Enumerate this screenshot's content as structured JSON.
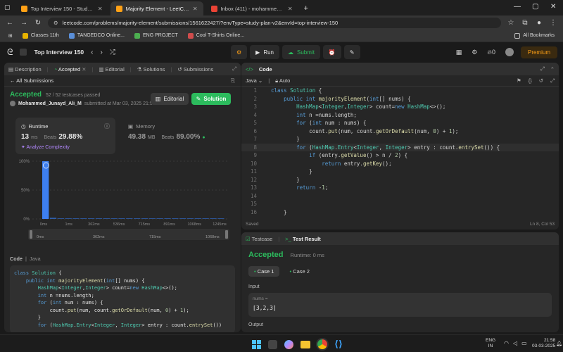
{
  "browser": {
    "tabs": [
      {
        "title": "Top Interview 150 - Study Plan",
        "color": "#ffa116"
      },
      {
        "title": "Majority Element - LeetCode",
        "color": "#ffa116"
      },
      {
        "title": "Inbox (411) - mohammedjunay",
        "color": "#ea4335"
      }
    ],
    "new_tab": "+",
    "url": "leetcode.com/problems/majority-element/submissions/1561622427/?envType=study-plan-v2&envId=top-interview-150",
    "bookmarks": [
      "Classes 11th",
      "TANGEDCO Online...",
      "ENG PROJECT",
      "Cool T-Shirts Online..."
    ],
    "all_bookmarks": "All Bookmarks"
  },
  "header": {
    "study_plan": "Top Interview 150",
    "run": "Run",
    "submit": "Submit",
    "streak": "0",
    "premium": "Premium"
  },
  "left": {
    "tabs": [
      "Description",
      "Accepted",
      "Editorial",
      "Solutions",
      "Submissions"
    ],
    "back": "All Submissions",
    "status": "Accepted",
    "testcases": "52 / 52 testcases passed",
    "user": "Mohammed_Junayd_Ali_M",
    "submitted": "submitted at Mar 03, 2025 21:57",
    "editorial_btn": "Editorial",
    "solution_btn": "Solution",
    "runtime_label": "Runtime",
    "runtime_value": "13",
    "runtime_unit": "ms",
    "runtime_beats_label": "Beats",
    "runtime_beats": "29.88%",
    "analyze": "Analyze Complexity",
    "memory_label": "Memory",
    "memory_value": "49.38",
    "memory_unit": "MB",
    "memory_beats_label": "Beats",
    "memory_beats": "89.00%",
    "code_label": "Code",
    "code_lang": "Java",
    "code": [
      "class Solution {",
      "    public int majorityElement(int[] nums) {",
      "        HashMap<Integer,Integer> count=new HashMap<>();",
      "        int n =nums.length;",
      "        for (int num : nums) {",
      "            count.put(num, count.getOrDefault(num, 0) + 1);",
      "        }",
      "        for (HashMap.Entry<Integer, Integer> entry : count.entrySet())"
    ]
  },
  "chart_data": {
    "type": "bar",
    "y_ticks": [
      "100%",
      "50%",
      "0%"
    ],
    "x_ticks": [
      "0ms",
      "1ms",
      "362ms",
      "536ms",
      "715ms",
      "891ms",
      "1068ms",
      "1245ms"
    ],
    "mini_ticks": [
      "0ms",
      "362ms",
      "715ms",
      "1068ms"
    ],
    "highlight_value": 13,
    "highlight_unit": "ms",
    "bars_percent": [
      100,
      2,
      1,
      1,
      1,
      1,
      1,
      1,
      1,
      1,
      1,
      1,
      1,
      1,
      1,
      1,
      1,
      1,
      1,
      1,
      1,
      1,
      1,
      1
    ]
  },
  "editor": {
    "title": "Code",
    "lang": "Java",
    "mode": "Auto",
    "saved": "Saved",
    "cursor": "Ln 8, Col 53",
    "lines": [
      "class Solution {",
      "    public int majorityElement(int[] nums) {",
      "        HashMap<Integer,Integer> count=new HashMap<>();",
      "        int n =nums.length;",
      "        for (int num : nums) {",
      "            count.put(num, count.getOrDefault(num, 0) + 1);",
      "        }",
      "        for (HashMap.Entry<Integer, Integer> entry : count.entrySet()) {",
      "            if (entry.getValue() > n / 2) {",
      "                return entry.getKey();",
      "            }",
      "        }",
      "        return -1;",
      "",
      "",
      "    }"
    ],
    "line_numbers": [
      "1",
      "2",
      "3",
      "4",
      "5",
      "6",
      "7",
      "8",
      "9",
      "10",
      "11",
      "12",
      "13",
      "14",
      "15",
      "16"
    ]
  },
  "testpanel": {
    "tab_testcase": "Testcase",
    "tab_result": "Test Result",
    "status": "Accepted",
    "runtime": "Runtime: 0 ms",
    "case1": "Case 1",
    "case2": "Case 2",
    "input_label": "Input",
    "var_label": "nums =",
    "var_value": "[3,2,3]",
    "output_label": "Output"
  },
  "taskbar": {
    "lang": "ENG",
    "region": "IN",
    "time": "21:58",
    "date": "03-03-2025"
  }
}
